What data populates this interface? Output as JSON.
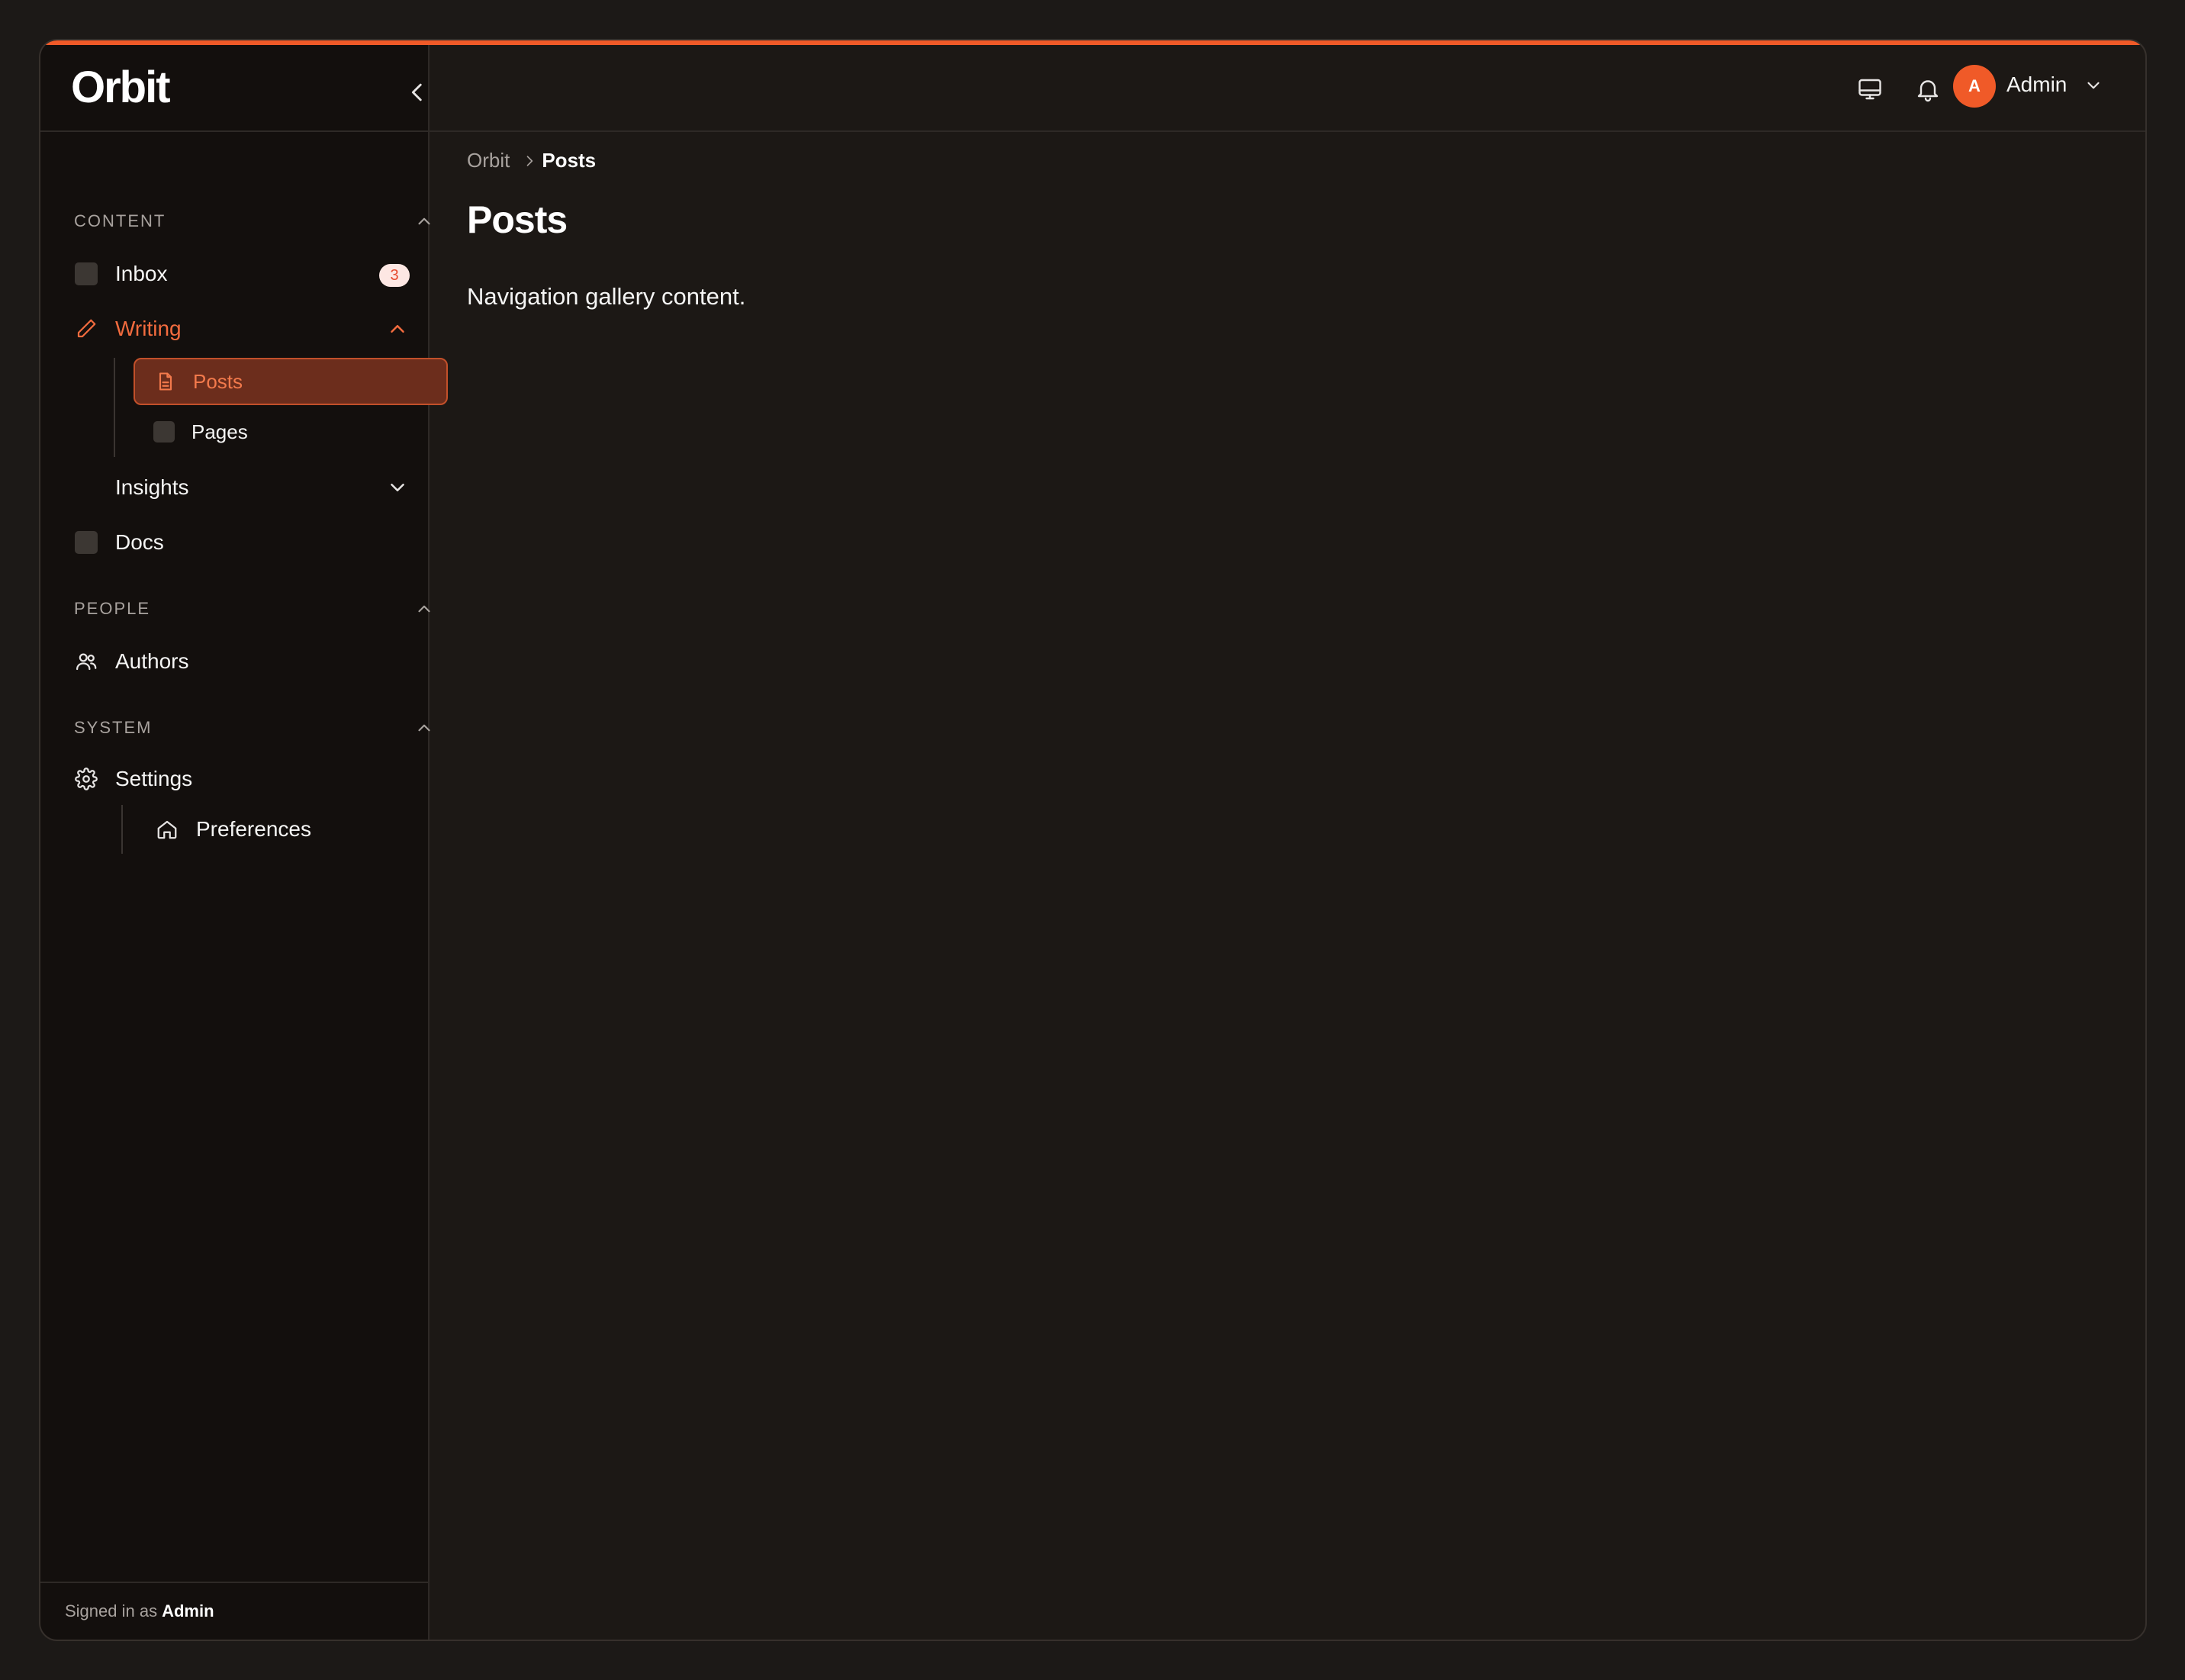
{
  "app": {
    "name": "Orbit",
    "accent_color": "#f05a28"
  },
  "sidebar": {
    "collapse_icon": "chevron-left-icon",
    "sections": [
      {
        "label": "CONTENT",
        "items": [
          {
            "label": "Inbox",
            "icon": "placeholder-square",
            "badge": "3"
          },
          {
            "label": "Writing",
            "icon": "pencil-icon",
            "expanded": true,
            "children": [
              {
                "label": "Posts",
                "icon": "file-text-icon",
                "active": true
              },
              {
                "label": "Pages",
                "icon": "placeholder-square"
              }
            ]
          },
          {
            "label": "Insights",
            "expanded": false
          },
          {
            "label": "Docs",
            "icon": "placeholder-square"
          }
        ]
      },
      {
        "label": "PEOPLE",
        "items": [
          {
            "label": "Authors",
            "icon": "users-icon"
          }
        ]
      },
      {
        "label": "SYSTEM",
        "items": [
          {
            "label": "Settings",
            "icon": "gear-icon",
            "children": [
              {
                "label": "Preferences",
                "icon": "home-icon"
              }
            ]
          }
        ]
      }
    ],
    "footer": {
      "prefix": "Signed in as",
      "user": "Admin"
    }
  },
  "topbar": {
    "icons": [
      "monitor-icon",
      "bell-icon"
    ],
    "user": {
      "initial": "A",
      "name": "Admin"
    }
  },
  "main": {
    "breadcrumb": [
      "Orbit",
      "Posts"
    ],
    "title": "Posts",
    "body": "Navigation gallery content."
  }
}
